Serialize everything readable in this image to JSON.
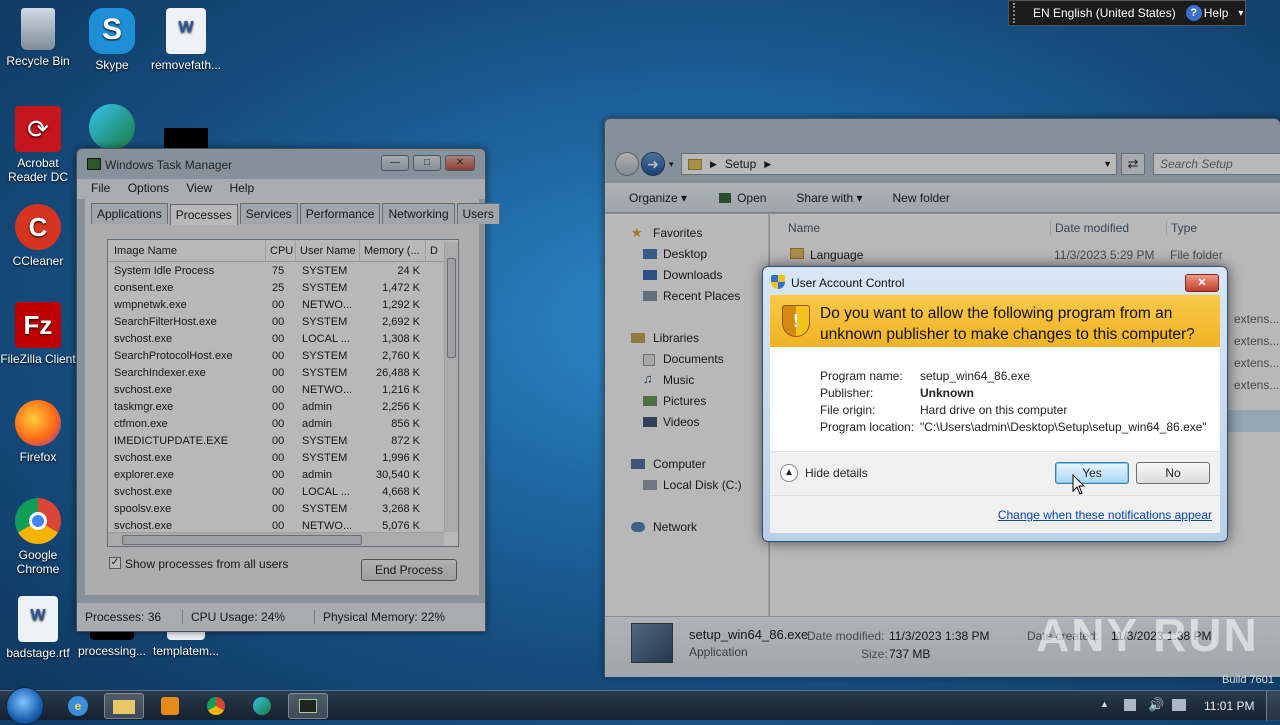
{
  "desktop_icons": [
    {
      "label": "Recycle Bin",
      "icon": "recycle-bin-icon"
    },
    {
      "label": "Skype",
      "icon": "skype-icon"
    },
    {
      "label": "removefath...",
      "icon": "word-doc-icon"
    },
    {
      "label": "Acrobat Reader DC",
      "icon": "acrobat-icon"
    },
    {
      "label": "CCleaner",
      "icon": "ccleaner-icon"
    },
    {
      "label": "FileZilla Client",
      "icon": "filezilla-icon"
    },
    {
      "label": "Firefox",
      "icon": "firefox-icon"
    },
    {
      "label": "Google Chrome",
      "icon": "chrome-icon"
    },
    {
      "label": "badstage.rtf",
      "icon": "word-doc-icon"
    },
    {
      "label": "processing...",
      "icon": "file-icon"
    },
    {
      "label": "templatem...",
      "icon": "file-icon"
    }
  ],
  "langbar": {
    "lang": "EN English (United States)",
    "help": "Help"
  },
  "taskmgr": {
    "title": "Windows Task Manager",
    "menu": [
      "File",
      "Options",
      "View",
      "Help"
    ],
    "tabs": [
      "Applications",
      "Processes",
      "Services",
      "Performance",
      "Networking",
      "Users"
    ],
    "columns": [
      "Image Name",
      "CPU",
      "User Name",
      "Memory (...",
      "D"
    ],
    "rows": [
      [
        "System Idle Process",
        "75",
        "SYSTEM",
        "24 K"
      ],
      [
        "consent.exe",
        "25",
        "SYSTEM",
        "1,472 K"
      ],
      [
        "wmpnetwk.exe",
        "00",
        "NETWO...",
        "1,292 K"
      ],
      [
        "SearchFilterHost.exe",
        "00",
        "SYSTEM",
        "2,692 K"
      ],
      [
        "svchost.exe",
        "00",
        "LOCAL ...",
        "1,308 K"
      ],
      [
        "SearchProtocolHost.exe",
        "00",
        "SYSTEM",
        "2,760 K"
      ],
      [
        "SearchIndexer.exe",
        "00",
        "SYSTEM",
        "26,488 K"
      ],
      [
        "svchost.exe",
        "00",
        "NETWO...",
        "1,216 K"
      ],
      [
        "taskmgr.exe",
        "00",
        "admin",
        "2,256 K"
      ],
      [
        "ctfmon.exe",
        "00",
        "admin",
        "856 K"
      ],
      [
        "IMEDICTUPDATE.EXE",
        "00",
        "SYSTEM",
        "872 K"
      ],
      [
        "svchost.exe",
        "00",
        "SYSTEM",
        "1,996 K"
      ],
      [
        "explorer.exe",
        "00",
        "admin",
        "30,540 K"
      ],
      [
        "svchost.exe",
        "00",
        "LOCAL ...",
        "4,668 K"
      ],
      [
        "spoolsv.exe",
        "00",
        "SYSTEM",
        "3,268 K"
      ],
      [
        "svchost.exe",
        "00",
        "NETWO...",
        "5,076 K"
      ]
    ],
    "show_all_label": "Show processes from all users",
    "end_process": "End Process",
    "status": {
      "processes": "Processes: 36",
      "cpu": "CPU Usage: 24%",
      "memory": "Physical Memory: 22%"
    }
  },
  "explorer": {
    "path": "Setup",
    "search_placeholder": "Search Setup",
    "toolbar": [
      "Organize",
      "Open",
      "Share with",
      "New folder"
    ],
    "columns": [
      "Name",
      "Date modified",
      "Type"
    ],
    "file_row": {
      "name": "Language",
      "date": "11/3/2023 5:29 PM",
      "type": "File folder"
    },
    "partial_type": "extens...",
    "nav": {
      "favorites": "Favorites",
      "desktop": "Desktop",
      "downloads": "Downloads",
      "recent": "Recent Places",
      "libraries": "Libraries",
      "documents": "Documents",
      "music": "Music",
      "pictures": "Pictures",
      "videos": "Videos",
      "computer": "Computer",
      "local_disk": "Local Disk (C:)",
      "network": "Network"
    },
    "details": {
      "name": "setup_win64_86.exe",
      "type": "Application",
      "date_label": "Date modified:",
      "date": "11/3/2023 1:38 PM",
      "size_label": "Size:",
      "size": "737 MB",
      "date_created_label": "Date created:",
      "date_created": "11/3/2023 1:38 PM"
    }
  },
  "uac": {
    "title": "User Account Control",
    "question": "Do you want to allow the following program from an unknown publisher to make changes to this computer?",
    "fields": [
      {
        "label": "Program name:",
        "value": "setup_win64_86.exe"
      },
      {
        "label": "Publisher:",
        "value": "Unknown"
      },
      {
        "label": "File origin:",
        "value": "Hard drive on this computer"
      },
      {
        "label": "Program location:",
        "value": "\"C:\\Users\\admin\\Desktop\\Setup\\setup_win64_86.exe\""
      }
    ],
    "hide_details": "Hide details",
    "yes": "Yes",
    "no": "No",
    "link": "Change when these notifications appear"
  },
  "watermark": "ANY RUN",
  "build": "Build 7601",
  "clock": "11:01 PM"
}
